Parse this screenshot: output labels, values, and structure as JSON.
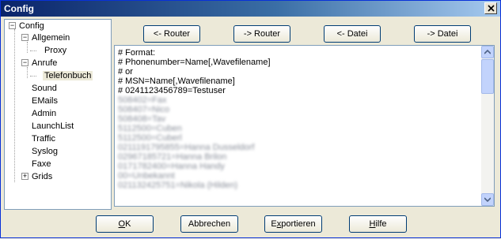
{
  "window": {
    "title": "Config"
  },
  "tree": {
    "root": "Config",
    "items": [
      {
        "label": "Allgemein"
      },
      {
        "label": "Proxy"
      },
      {
        "label": "Anrufe"
      },
      {
        "label": "Telefonbuch"
      },
      {
        "label": "Sound"
      },
      {
        "label": "EMails"
      },
      {
        "label": "Admin"
      },
      {
        "label": "LaunchList"
      },
      {
        "label": "Traffic"
      },
      {
        "label": "Syslog"
      },
      {
        "label": "Faxe"
      },
      {
        "label": "Grids"
      }
    ]
  },
  "toolbar": {
    "to_router_in": "<- Router",
    "to_router_out": "-> Router",
    "from_file": "<- Datei",
    "to_file": "-> Datei"
  },
  "editor": {
    "lines": [
      "# Format:",
      "# Phonenumber=Name[,Wavefilename]",
      "# or",
      "# MSN=Name[,Wavefilename]",
      "# 0241123456789=Testuser"
    ],
    "blurred_lines": [
      "508402=Fax",
      "508407=Nico",
      "508408=Tav",
      "5112500=Cuben",
      "5112500=Cuberl",
      "0211191795855=Hanna Dusseldorf",
      "02967185721=Hanna Brilon",
      "0171782400=Hanna Handy",
      "00=Unbekannt",
      "021132425751=Nikola (Hilden)"
    ]
  },
  "buttons": {
    "ok_u": "O",
    "ok_rest": "K",
    "cancel": "Abbrechen",
    "export_pre": "E",
    "export_u": "x",
    "export_rest": "portieren",
    "help_u": "H",
    "help_rest": "ilfe"
  }
}
